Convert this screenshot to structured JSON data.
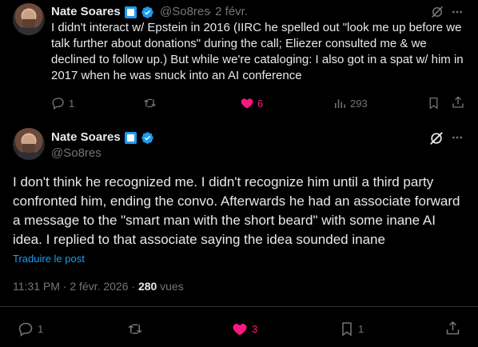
{
  "reply": {
    "author": "Nate Soares",
    "handle": "@So8res",
    "time": "· 2 févr.",
    "text": "I didn't interact w/ Epstein in 2016 (IIRC he spelled out \"look me up before we talk further about donations\" during the call; Eliezer consulted me & we declined to follow up.) But while we're cataloging: I also got in a spat w/ him in 2017 when he was snuck into an AI conference",
    "replies": "1",
    "likes": "6",
    "views": "293"
  },
  "main": {
    "author": "Nate Soares",
    "handle": "@So8res",
    "text": "I don't think he recognized me. I didn't recognize him until a third party confronted him, ending the convo. Afterwards he had an associate forward a message to the \"smart man with the short beard\" with some inane AI idea. I replied to that associate saying the idea sounded inane",
    "translate": "Traduire le post",
    "timestamp": "11:31 PM · 2 févr. 2026 · ",
    "views_count": "280",
    "views_label": " vues",
    "replies": "1",
    "likes": "3",
    "bookmarks": "1"
  },
  "colors": {
    "accent": "#1d9bf0",
    "like": "#f91880",
    "muted": "#71767b",
    "text": "#e7e9ea",
    "background": "#000000"
  },
  "icons": [
    "grok-icon",
    "more-icon",
    "reply-icon",
    "retweet-icon",
    "heart-filled-icon",
    "views-icon",
    "bookmark-icon",
    "share-icon",
    "verified-badge-icon",
    "subscriber-square-icon"
  ]
}
